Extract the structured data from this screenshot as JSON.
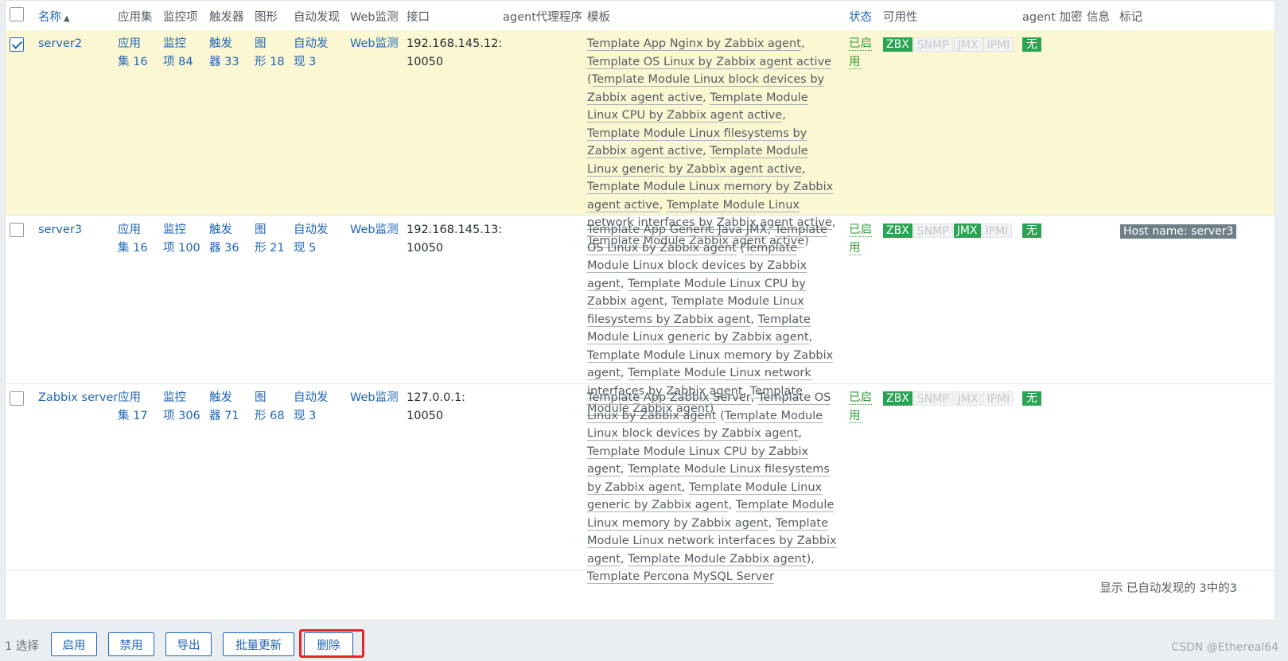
{
  "header": {
    "name": "名称",
    "sort_arrow": "▲",
    "applications": "应用集",
    "items": "监控项",
    "triggers": "触发器",
    "graphs": "图形",
    "discovery": "自动发现",
    "web": "Web监测",
    "interface": "接口",
    "proxy": "agent代理程序",
    "templates": "模板",
    "status": "状态",
    "availability": "可用性",
    "encryption": "agent 加密",
    "info": "信息",
    "tags": "标记"
  },
  "rows": [
    {
      "selected": true,
      "name": "server2",
      "applications": "应用\n集 16",
      "items": "监控\n项 84",
      "triggers": "触发\n器 33",
      "graphs": "图\n形 18",
      "discovery": "自动发\n现 3",
      "web": "Web监测",
      "interface": "192.168.145.12:\n10050",
      "templates": [
        "Template App Nginx by Zabbix agent",
        ", ",
        "Template OS Linux by Zabbix agent active",
        " (",
        "Template Module Linux block devices by Zabbix agent active",
        ", ",
        "Template Module Linux CPU by Zabbix agent active",
        ", ",
        "Template Module Linux filesystems by Zabbix agent active",
        ", ",
        "Template Module Linux generic by Zabbix agent active",
        ", ",
        "Template Module Linux memory by Zabbix agent active",
        ", ",
        "Template Module Linux network interfaces by Zabbix agent active",
        ", ",
        "Template Module Zabbix agent active",
        ")"
      ],
      "status": "已启\n用",
      "encryption": "无",
      "tag": ""
    },
    {
      "selected": false,
      "name": "server3",
      "applications": "应用\n集 16",
      "items": "监控\n项 100",
      "triggers": "触发\n器 36",
      "graphs": "图\n形 21",
      "discovery": "自动发\n现 5",
      "web": "Web监测",
      "interface": "192.168.145.13:\n10050",
      "templates": [
        "Template App Generic Java JMX",
        ", ",
        "Template OS Linux by Zabbix agent",
        " (",
        "Template Module Linux block devices by Zabbix agent",
        ", ",
        "Template Module Linux CPU by Zabbix agent",
        ", ",
        "Template Module Linux filesystems by Zabbix agent",
        ", ",
        "Template Module Linux generic by Zabbix agent",
        ", ",
        "Template Module Linux memory by Zabbix agent",
        ", ",
        "Template Module Linux network interfaces by Zabbix agent",
        ", ",
        "Template Module Zabbix agent",
        ")"
      ],
      "status": "已启\n用",
      "encryption": "无",
      "tag": "Host name: server3"
    },
    {
      "selected": false,
      "name": "Zabbix server",
      "applications": "应用\n集 17",
      "items": "监控\n项 306",
      "triggers": "触发\n器 71",
      "graphs": "图\n形 68",
      "discovery": "自动发\n现 3",
      "web": "Web监测",
      "interface": "127.0.0.1:\n10050",
      "templates": [
        "Template App Zabbix Server",
        ", ",
        "Template OS Linux by Zabbix agent",
        " (",
        "Template Module Linux block devices by Zabbix agent",
        ", ",
        "Template Module Linux CPU by Zabbix agent",
        ", ",
        "Template Module Linux filesystems by Zabbix agent",
        ", ",
        "Template Module Linux generic by Zabbix agent",
        ", ",
        "Template Module Linux memory by Zabbix agent",
        ", ",
        "Template Module Linux network interfaces by Zabbix agent",
        ", ",
        "Template Module Zabbix agent",
        "), ",
        "Template Percona MySQL Server",
        ""
      ],
      "status": "已启\n用",
      "encryption": "无",
      "tag": ""
    }
  ],
  "availability_labels": {
    "zbx": "ZBX",
    "snmp": "SNMP",
    "jmx": "JMX",
    "ipmi": "IPMI"
  },
  "availability_state": [
    {
      "zbx": true,
      "snmp": false,
      "jmx": false,
      "ipmi": false
    },
    {
      "zbx": true,
      "snmp": false,
      "jmx": true,
      "ipmi": false
    },
    {
      "zbx": true,
      "snmp": false,
      "jmx": false,
      "ipmi": false
    }
  ],
  "footer": {
    "summary": "显示 已自动发现的 3中的3",
    "selected_count": "1 选择",
    "enable": "启用",
    "disable": "禁用",
    "export": "导出",
    "mass_update": "批量更新",
    "delete": "删除",
    "watermark": "CSDN @Ethereal64"
  },
  "colors": {
    "link": "#1f65b8",
    "green": "#2aa352",
    "selected_row": "#fbf7d2",
    "highlight": "#e5252a"
  }
}
